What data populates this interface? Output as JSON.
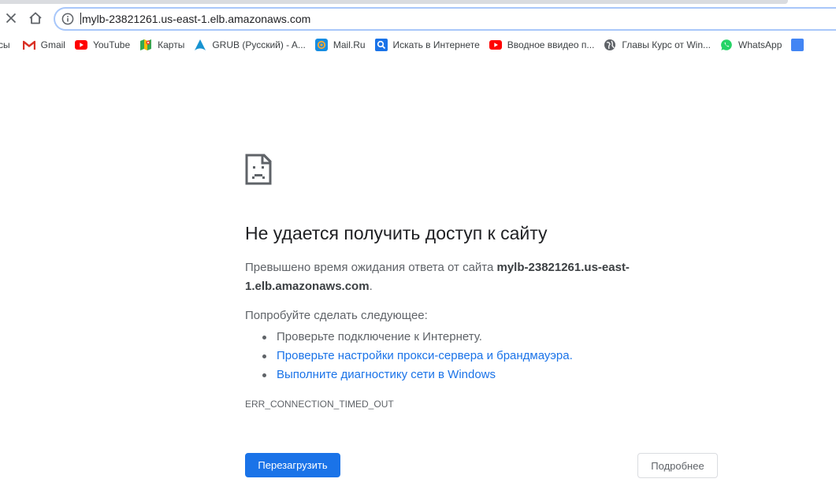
{
  "browser": {
    "address": "mylb-23821261.us-east-1.elb.amazonaws.com",
    "close_icon": "close-icon",
    "home_icon": "home-icon",
    "info_icon": "info-icon"
  },
  "bookmarks": [
    {
      "label": "сы",
      "icon": "apps-icon"
    },
    {
      "label": "Gmail",
      "icon": "gmail-icon"
    },
    {
      "label": "YouTube",
      "icon": "youtube-icon"
    },
    {
      "label": "Карты",
      "icon": "maps-icon"
    },
    {
      "label": "GRUB (Русский) - A...",
      "icon": "arch-icon"
    },
    {
      "label": "Mail.Ru",
      "icon": "mailru-icon"
    },
    {
      "label": "Искать в Интернете",
      "icon": "search-icon"
    },
    {
      "label": "Вводное ввидео п...",
      "icon": "youtube-icon"
    },
    {
      "label": "Главы Курс от Win...",
      "icon": "globe-icon"
    },
    {
      "label": "WhatsApp",
      "icon": "whatsapp-icon"
    }
  ],
  "error": {
    "title": "Не удается получить доступ к сайту",
    "desc_prefix": "Превышено время ожидания ответа от сайта ",
    "desc_host": "mylb-23821261.us-east-1.elb.amazonaws.com",
    "desc_suffix": ".",
    "try_label": "Попробуйте сделать следующее:",
    "suggestions": [
      "Проверьте подключение к Интернету.",
      "Проверьте настройки прокси-сервера и брандмауэра.",
      "Выполните диагностику сети в Windows"
    ],
    "code": "ERR_CONNECTION_TIMED_OUT",
    "reload_label": "Перезагрузить",
    "details_label": "Подробнее"
  },
  "colors": {
    "accent": "#1a73e8",
    "text": "#202124",
    "muted": "#5f6368"
  }
}
